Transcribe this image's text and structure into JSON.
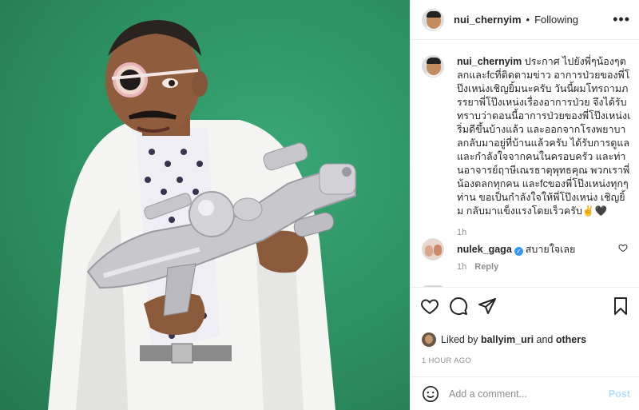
{
  "post": {
    "author": "nui_chernyim",
    "separator": "•",
    "follow_status": "Following",
    "more_icon": "more-horizontal-icon"
  },
  "caption": {
    "username": "nui_chernyim",
    "text": "ประกาศ ไปยังพี่ๆน้องๆตลกและfcที่ติดตามข่าว อาการป่วยของพี่โป๊งเหน่งเชิญยิ้มนะครับ วันนี้ผมโทรถามภรรยาพี่โป๊งเหน่งเรื่องอาการป่วย จึงได้รับทราบว่าตอนนี้อาการป่วยของพี่โป๊งเหน่งเริ่มดีขึ้นบ้างแล้ว และออกจากโรงพยาบาลกลับมาอยู่ที่บ้านแล้วครับ ได้รับการดูแลและกำลังใจจากคนในครอบครัว และท่านอาจารย์ฤาษีเณรธาตุพุทธคุณ พวกเราพี่น้องตลกทุกคน และfcของพี่โป๊งเหน่งทุกๆท่าน ขอเป็นกำลังใจให้พี่โป๊งเหน่ง เชิญยิ้ม กลับมาแข็งแรงโดยเร็วครับ✌️🖤",
    "time": "1h"
  },
  "comments": [
    {
      "username": "nulek_gaga",
      "verified": true,
      "text": "สบายใจเลย",
      "time": "1h",
      "reply_label": "Reply"
    }
  ],
  "likes": {
    "prefix": "Liked by",
    "user": "ballyim_uri",
    "conjunction": "and",
    "others": "others"
  },
  "timestamp": "1 HOUR AGO",
  "composer": {
    "placeholder": "Add a comment...",
    "post_label": "Post"
  },
  "colors": {
    "photo_background": "#2f9a67",
    "verified_badge": "#3897f0",
    "post_button_disabled": "#b2dffc",
    "muted_text": "#8e8e8e"
  }
}
